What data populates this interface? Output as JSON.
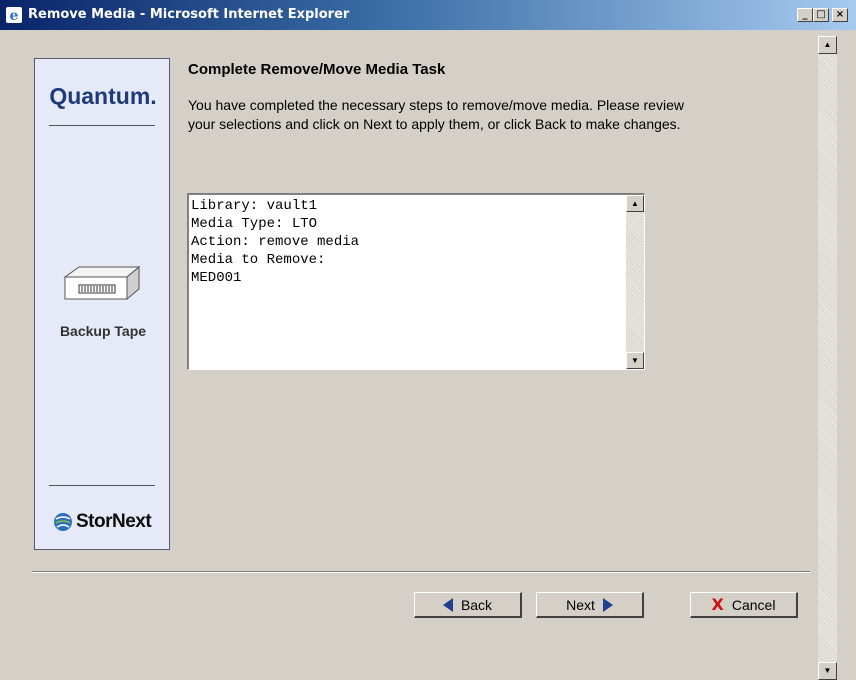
{
  "window": {
    "title": "Remove Media - Microsoft Internet Explorer",
    "minimize_glyph": "_",
    "maximize_glyph": "□",
    "close_glyph": "×"
  },
  "sidebar": {
    "brand": "Quantum.",
    "media_label": "Backup Tape",
    "product": "StorNext"
  },
  "main": {
    "heading": "Complete Remove/Move Media Task",
    "description": "You have completed the necessary steps to remove/move media. Please review your selections and click on Next to apply them, or click Back to make changes.",
    "summary": "Library: vault1\nMedia Type: LTO\nAction: remove media\nMedia to Remove:\nMED001"
  },
  "buttons": {
    "back": "Back",
    "next": "Next",
    "cancel": "Cancel",
    "cancel_glyph": "X"
  },
  "colors": {
    "titlebar_start": "#0a246a",
    "brand_blue": "#1e3a7b",
    "sidebar_bg": "#e6eaf8",
    "nav_arrow": "#1f3f8f",
    "cancel_x": "#cc1111"
  }
}
